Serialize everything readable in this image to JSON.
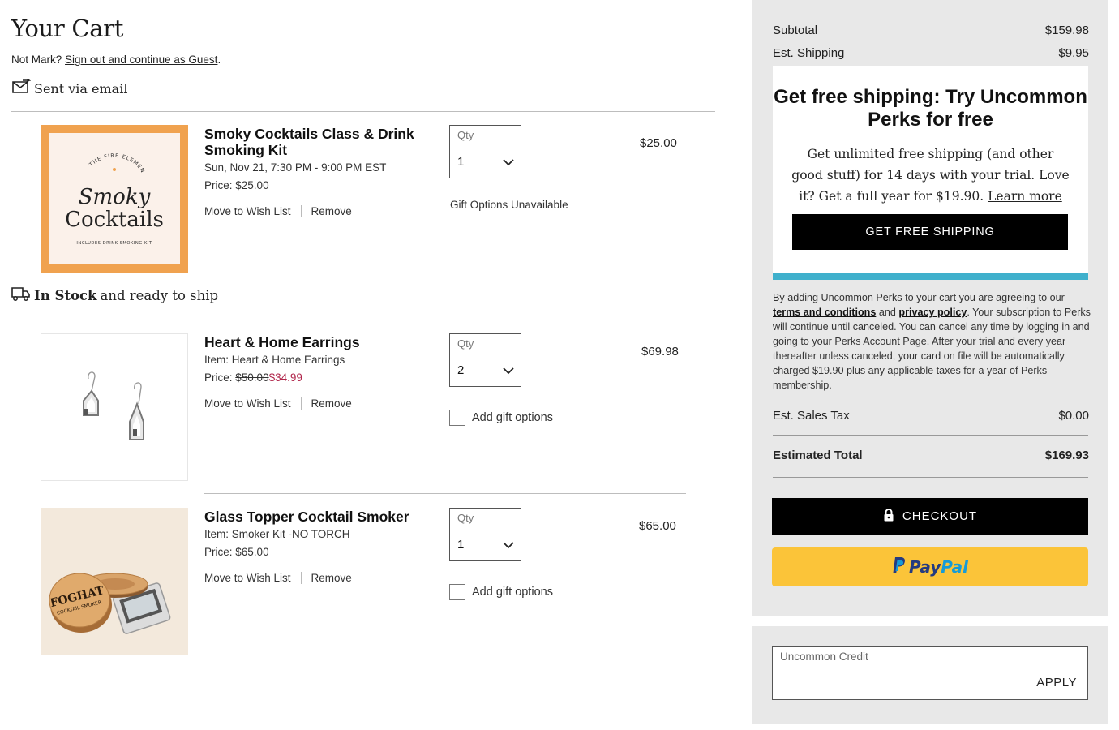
{
  "header": {
    "title": "Your Cart",
    "not_user_prefix": "Not Mark?",
    "sign_out_link": "Sign out and continue as Guest",
    "not_user_suffix": ".",
    "sent_via_email": "Sent via email"
  },
  "shipping_status": {
    "in_stock": "In Stock",
    "ready_text": "and ready to ship"
  },
  "thumb1": {
    "small_text": "THE FIRE ELEMENT",
    "line1": "Smoky",
    "line2": "Cocktails",
    "footer": "INCLUDES DRINK SMOKING KIT"
  },
  "thumb3": {
    "lid_text1": "FOGHAT",
    "lid_text2": "COCKTAIL SMOKER"
  },
  "items": [
    {
      "title": "Smoky Cocktails Class & Drink Smoking Kit",
      "detail": "Sun, Nov 21, 7:30 PM - 9:00 PM EST",
      "price_label": "Price:",
      "price": "$25.00",
      "move_to_wish": "Move to Wish List",
      "remove": "Remove",
      "qty_label": "Qty",
      "qty": "1",
      "line_total": "$25.00",
      "gift": "Gift Options Unavailable"
    },
    {
      "title": "Heart & Home Earrings",
      "detail": "Item: Heart & Home Earrings",
      "price_label": "Price:",
      "old_price": "$50.00",
      "sale_price": "$34.99",
      "move_to_wish": "Move to Wish List",
      "remove": "Remove",
      "qty_label": "Qty",
      "qty": "2",
      "line_total": "$69.98",
      "gift": "Add gift options"
    },
    {
      "title": "Glass Topper Cocktail Smoker",
      "detail": "Item: Smoker Kit -NO TORCH",
      "price_label": "Price:",
      "price": "$65.00",
      "move_to_wish": "Move to Wish List",
      "remove": "Remove",
      "qty_label": "Qty",
      "qty": "1",
      "line_total": "$65.00",
      "gift": "Add gift options"
    }
  ],
  "summary": {
    "subtotal_label": "Subtotal",
    "subtotal": "$159.98",
    "shipping_label": "Est. Shipping",
    "shipping": "$9.95",
    "tax_label": "Est. Sales Tax",
    "tax": "$0.00",
    "total_label": "Estimated Total",
    "total": "$169.93",
    "checkout": "CHECKOUT",
    "paypal_1": "Pay",
    "paypal_2": "Pal"
  },
  "perks": {
    "title": "Get free shipping: Try Uncommon Perks for free",
    "text": "Get unlimited free shipping (and other good stuff) for 14 days with your trial. Love it? Get a full year for $19.90.",
    "learn_more": "Learn more",
    "button": "GET FREE SHIPPING",
    "terms_prefix": "By adding Uncommon Perks to your cart you are agreeing to our",
    "terms_link": "terms and conditions",
    "terms_and": "and",
    "privacy_link": "privacy policy",
    "terms_suffix": ". Your subscription to Perks will continue until canceled. You can cancel any time by logging in and going to your Perks Account Page. After your trial and every year thereafter unless canceled, your card on file will be automatically charged $19.90 plus any applicable taxes for a year of Perks membership."
  },
  "credit": {
    "label": "Uncommon Credit",
    "apply": "APPLY"
  },
  "colors": {
    "accent_bar": "#3fb0cc",
    "sale": "#b0254a",
    "paypal_bg": "#fbc439",
    "thumb_border": "#f0a24f"
  }
}
